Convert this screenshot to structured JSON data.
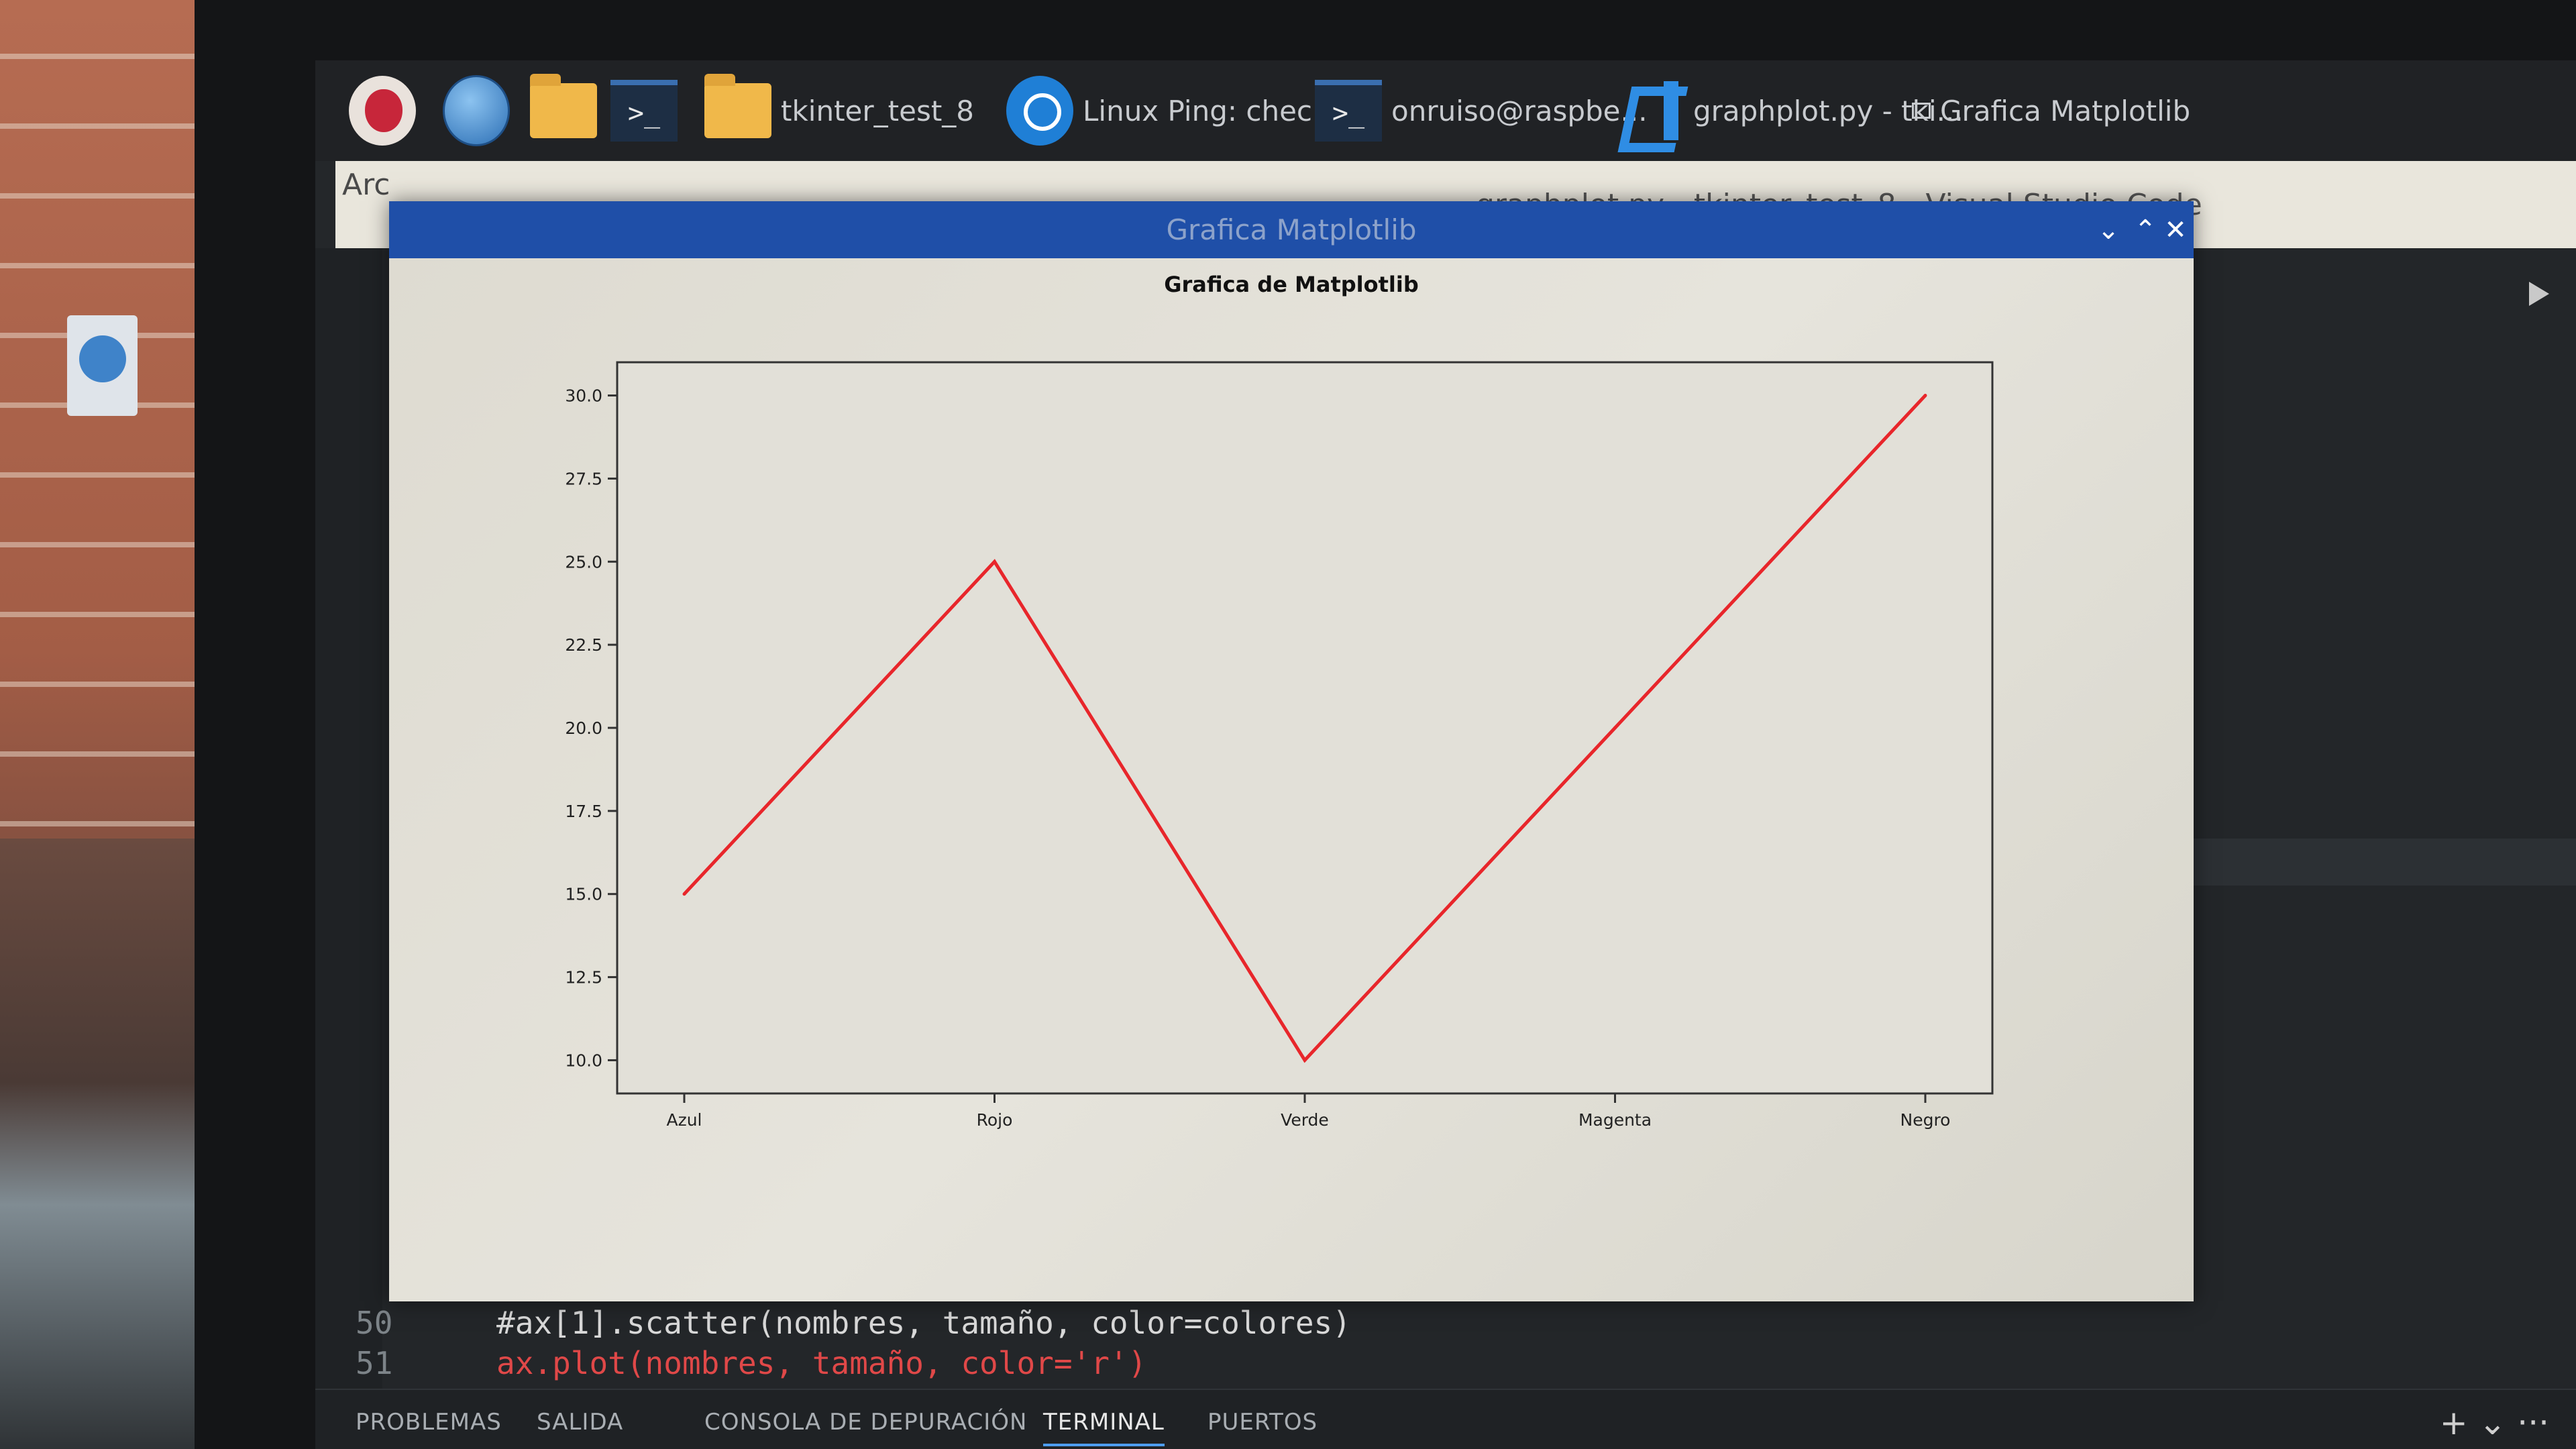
{
  "taskbar": {
    "items": [
      {
        "icon": "raspberry-pi-icon",
        "label": ""
      },
      {
        "icon": "globe-icon",
        "label": ""
      },
      {
        "icon": "folder-icon",
        "label": ""
      },
      {
        "icon": "terminal-icon",
        "label": ">_"
      },
      {
        "icon": "folder-icon",
        "label": "tkinter_test_8"
      },
      {
        "icon": "chromium-icon",
        "label": "Linux Ping: chec..."
      },
      {
        "icon": "terminal-icon",
        "label": "onruiso@raspbe..."
      },
      {
        "icon": "vscode-icon",
        "label": "graphplot.py - tki..."
      },
      {
        "icon": "window-icon",
        "label": "Grafica Matplotlib"
      }
    ]
  },
  "vscode": {
    "title": "graphplot.py - tkinter_test_8 - Visual Studio Code",
    "menu_first": "Arc",
    "code": [
      {
        "line": "50",
        "text": "#ax[1].scatter(nombres, tamaño, color=colores)"
      },
      {
        "line": "51",
        "text": "ax.plot(nombres, tamaño, color='r')"
      }
    ],
    "panel_tabs": [
      "PROBLEMAS",
      "SALIDA",
      "CONSOLA DE DEPURACIÓN",
      "TERMINAL",
      "PUERTOS"
    ],
    "active_tab": "TERMINAL",
    "panel_actions": "+ ⌄  ···"
  },
  "mpl_window": {
    "title": "Grafica Matplotlib",
    "buttons": {
      "minimize": "⌄",
      "maximize": "⌃",
      "close": "✕"
    }
  },
  "chart_data": {
    "type": "line",
    "title": "Grafica de Matplotlib",
    "categories": [
      "Azul",
      "Rojo",
      "Verde",
      "Magenta",
      "Negro"
    ],
    "values": [
      15,
      25,
      10,
      20,
      30
    ],
    "yticks": [
      "10.0",
      "12.5",
      "15.0",
      "17.5",
      "20.0",
      "22.5",
      "25.0",
      "27.5",
      "30.0"
    ],
    "ylim": [
      9,
      31
    ],
    "line_color": "#e8262b",
    "xlabel": "",
    "ylabel": "",
    "grid": false
  }
}
